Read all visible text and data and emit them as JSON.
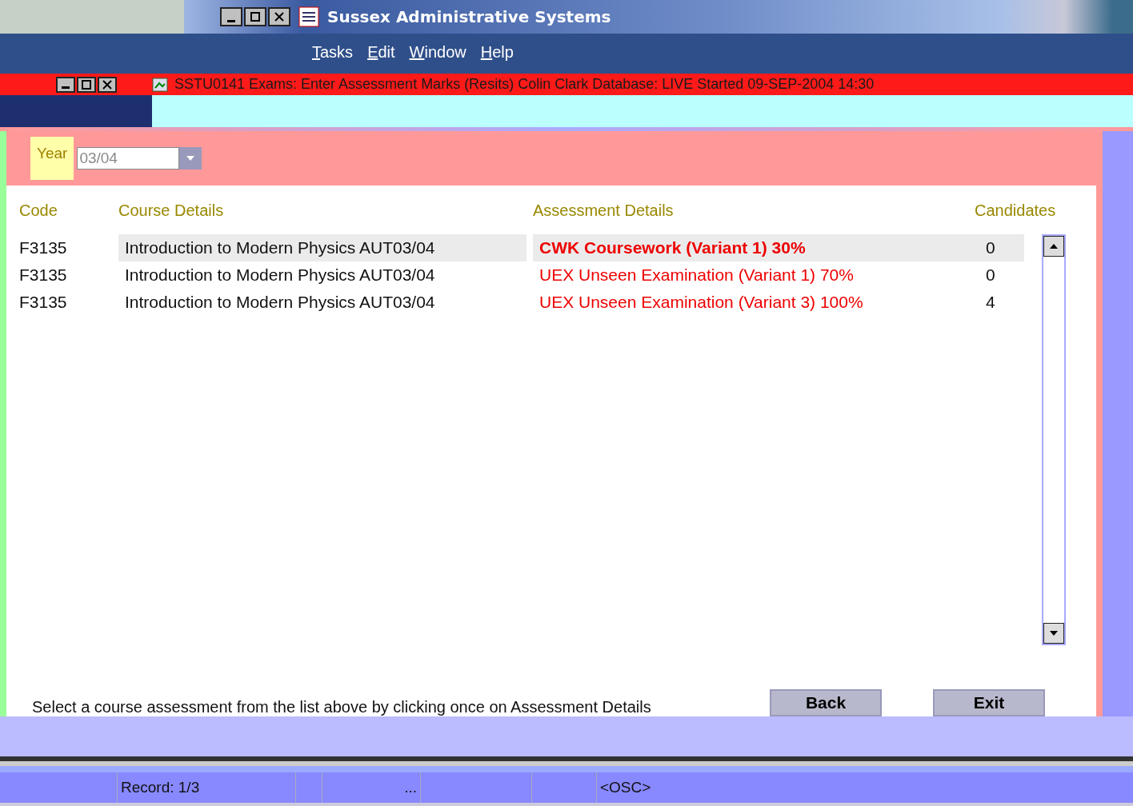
{
  "app_window": {
    "title": "Sussex Administrative Systems"
  },
  "menu": [
    "Tasks",
    "Edit",
    "Window",
    "Help"
  ],
  "form_window": {
    "title": "SSTU0141  Exams: Enter Assessment Marks (Resits) Colin Clark  Database: LIVE  Started 09-SEP-2004 14:30"
  },
  "year": {
    "label": "Year",
    "value": "03/04"
  },
  "table": {
    "columns": [
      "Code",
      "Course Details",
      "Assessment Details",
      "Candidates"
    ],
    "rows": [
      {
        "code": "F3135",
        "course": "Introduction to Modern Physics AUT03/04",
        "assessment": "CWK Coursework (Variant 1) 30%",
        "candidates": "0",
        "selected": true
      },
      {
        "code": "F3135",
        "course": "Introduction to Modern Physics AUT03/04",
        "assessment": "UEX Unseen Examination (Variant 1) 70%",
        "candidates": "0",
        "selected": false
      },
      {
        "code": "F3135",
        "course": "Introduction to Modern Physics AUT03/04",
        "assessment": "UEX Unseen Examination (Variant 3) 100%",
        "candidates": "4",
        "selected": false
      }
    ]
  },
  "hint": "Select a course assessment from the list above by clicking once on Assessment Details",
  "buttons": [
    "Back",
    "Exit"
  ],
  "status_bar": {
    "record": "Record: 1/3",
    "ellipsis": "...",
    "mode": "<OSC>"
  }
}
